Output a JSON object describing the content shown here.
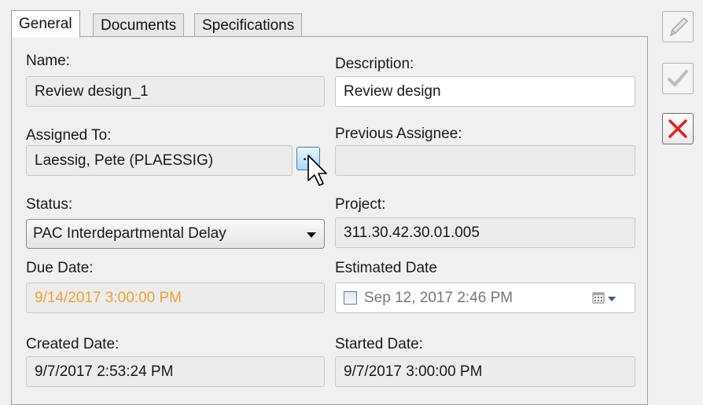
{
  "tabs": [
    {
      "label": "General"
    },
    {
      "label": "Documents"
    },
    {
      "label": "Specifications"
    }
  ],
  "form": {
    "name_label": "Name:",
    "name_value": "Review design_1",
    "description_label": "Description:",
    "description_value": "Review design",
    "assigned_label": "Assigned To:",
    "assigned_value": "Laessig, Pete (PLAESSIG)",
    "assigned_button": "...",
    "previous_label": "Previous Assignee:",
    "previous_value": "",
    "status_label": "Status:",
    "status_value": "PAC Interdepartmental Delay",
    "project_label": "Project:",
    "project_value": "311.30.42.30.01.005",
    "due_label": "Due Date:",
    "due_value": "9/14/2017 3:00:00 PM",
    "estimated_label": "Estimated Date",
    "estimated_value": "Sep 12, 2017  2:46 PM",
    "created_label": "Created Date:",
    "created_value": "9/7/2017 2:53:24 PM",
    "started_label": "Started Date:",
    "started_value": "9/7/2017 3:00:00 PM"
  },
  "colors": {
    "due_date_text": "#f0a030",
    "delete_icon": "#e02020"
  },
  "side_buttons": [
    {
      "icon": "pencil-icon"
    },
    {
      "icon": "checkmark-icon"
    },
    {
      "icon": "delete-x-icon"
    }
  ]
}
